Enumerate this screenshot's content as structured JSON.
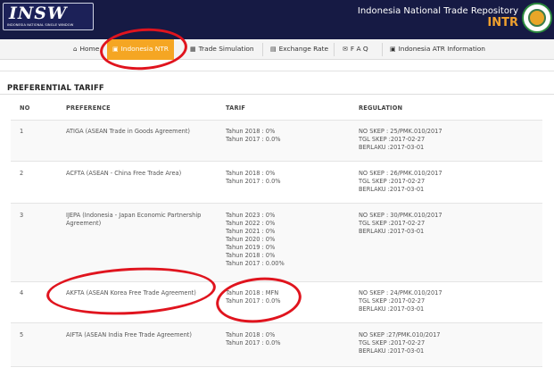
{
  "header": {
    "logo_text": "INSW",
    "logo_sub": "INDONESIA NATIONAL SINGLE WINDOW",
    "site_title": "Indonesia National Trade Repository",
    "site_abbr": "INTR"
  },
  "nav": {
    "home": "Home",
    "indonesia_ntr": "Indonesia NTR",
    "trade_simulation": "Trade Simulation",
    "exchange_rate": "Exchange Rate",
    "faq": "F A Q",
    "indonesia_atr": "Indonesia ATR Information"
  },
  "section": {
    "title": "PREFERENTIAL TARIFF"
  },
  "table": {
    "headers": {
      "no": "NO",
      "preference": "PREFERENCE",
      "tarif": "TARIF",
      "regulation": "REGULATION"
    },
    "rows": [
      {
        "no": "1",
        "preference": "ATIGA (ASEAN Trade in Goods Agreement)",
        "tarif": [
          "Tahun 2018 : 0%",
          "Tahun 2017 : 0.0%"
        ],
        "regulation": [
          "NO SKEP : 25/PMK.010/2017",
          "TGL SKEP :2017-02-27",
          "BERLAKU :2017-03-01"
        ]
      },
      {
        "no": "2",
        "preference": "ACFTA (ASEAN - China Free Trade Area)",
        "tarif": [
          "Tahun 2018 : 0%",
          "Tahun 2017 : 0.0%"
        ],
        "regulation": [
          "NO SKEP : 26/PMK.010/2017",
          "TGL SKEP :2017-02-27",
          "BERLAKU :2017-03-01"
        ]
      },
      {
        "no": "3",
        "preference": "IJEPA (Indonesia - Japan Economic Partnership Agreement)",
        "tarif": [
          "Tahun 2023 : 0%",
          "Tahun 2022 : 0%",
          "Tahun 2021 : 0%",
          "Tahun 2020 : 0%",
          "Tahun 2019 : 0%",
          "Tahun 2018 : 0%",
          "Tahun 2017 : 0.00%"
        ],
        "regulation": [
          "NO SKEP : 30/PMK.010/2017",
          "TGL SKEP :2017-02-27",
          "BERLAKU :2017-03-01"
        ]
      },
      {
        "no": "4",
        "preference": "AKFTA (ASEAN Korea Free Trade Agreement)",
        "tarif": [
          "Tahun 2018 : MFN",
          "Tahun 2017 : 0.0%"
        ],
        "regulation": [
          "NO SKEP : 24/PMK.010/2017",
          "TGL SKEP :2017-02-27",
          "BERLAKU :2017-03-01"
        ]
      },
      {
        "no": "5",
        "preference": "AIFTA (ASEAN India Free Trade Agreement)",
        "tarif": [
          "Tahun 2018 : 0%",
          "Tahun 2017 : 0.0%"
        ],
        "regulation": [
          "NO SKEP :27/PMK.010/2017",
          "TGL SKEP :2017-02-27",
          "BERLAKU :2017-03-01"
        ]
      }
    ]
  },
  "colors": {
    "header_bg": "#161a44",
    "active_tab": "#f5a623",
    "accent": "#f0a12e",
    "annotation": "#e0141e"
  }
}
